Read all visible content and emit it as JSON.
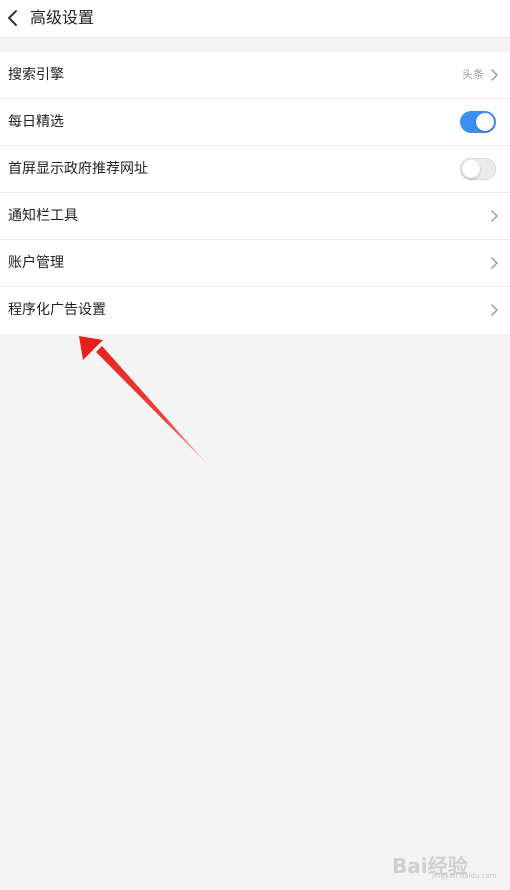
{
  "header": {
    "title": "高级设置",
    "back_icon": "chevron-left-icon"
  },
  "settings": [
    {
      "label": "搜索引擎",
      "value": "头条",
      "control": "chevron"
    },
    {
      "label": "每日精选",
      "control": "toggle",
      "toggle_on": true
    },
    {
      "label": "首屏显示政府推荐网址",
      "control": "toggle",
      "toggle_on": false
    },
    {
      "label": "通知栏工具",
      "control": "chevron"
    },
    {
      "label": "账户管理",
      "control": "chevron"
    },
    {
      "label": "程序化广告设置",
      "control": "chevron"
    }
  ],
  "colors": {
    "toggle_on": "#3a8ef6",
    "toggle_off": "#ebebeb",
    "annotation_arrow": "#e8201c",
    "background": "#f4f4f4"
  },
  "watermark": {
    "text": "Bai经验",
    "sub": "jingyan.baidu.com"
  }
}
